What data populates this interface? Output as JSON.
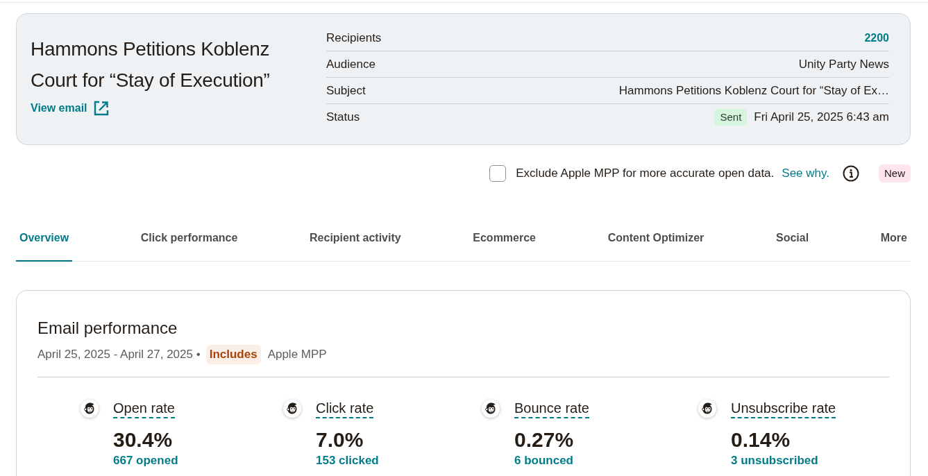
{
  "campaign": {
    "title": "Hammons Petitions Koblenz Court for “Stay of Execution”",
    "view_link": "View email"
  },
  "details": [
    {
      "kind": "link",
      "label": "Recipients",
      "value": "2200"
    },
    {
      "kind": "text",
      "label": "Audience",
      "value": "Unity Party News"
    },
    {
      "kind": "text",
      "label": "Subject",
      "value": "Hammons Petitions Koblenz Court for “Stay of Ex…"
    },
    {
      "kind": "status",
      "label": "Status",
      "badge": "Sent",
      "value": "Fri April 25, 2025 6:43 am"
    }
  ],
  "mpp_option": {
    "checked": false,
    "label": "Exclude Apple MPP for more accurate open data.",
    "link": "See why.",
    "badge": "New"
  },
  "tabs": [
    {
      "label": "Overview",
      "selected": true
    },
    {
      "label": "Click performance",
      "selected": false
    },
    {
      "label": "Recipient activity",
      "selected": false
    },
    {
      "label": "Ecommerce",
      "selected": false
    },
    {
      "label": "Content Optimizer",
      "selected": false
    },
    {
      "label": "Social",
      "selected": false
    },
    {
      "label": "More",
      "selected": false
    }
  ],
  "email_performance": {
    "title": "Email performance",
    "date_range": "April 25, 2025 - April 27, 2025 •",
    "badge": "Includes",
    "badge_note": "Apple MPP",
    "metrics": [
      {
        "label": "Open rate",
        "value": "30.4%",
        "detail": "667 opened"
      },
      {
        "label": "Click rate",
        "value": "7.0%",
        "detail": "153 clicked"
      },
      {
        "label": "Bounce rate",
        "value": "0.27%",
        "detail": "6 bounced"
      },
      {
        "label": "Unsubscribe rate",
        "value": "0.14%",
        "detail": "3 unsubscribed"
      }
    ]
  }
}
